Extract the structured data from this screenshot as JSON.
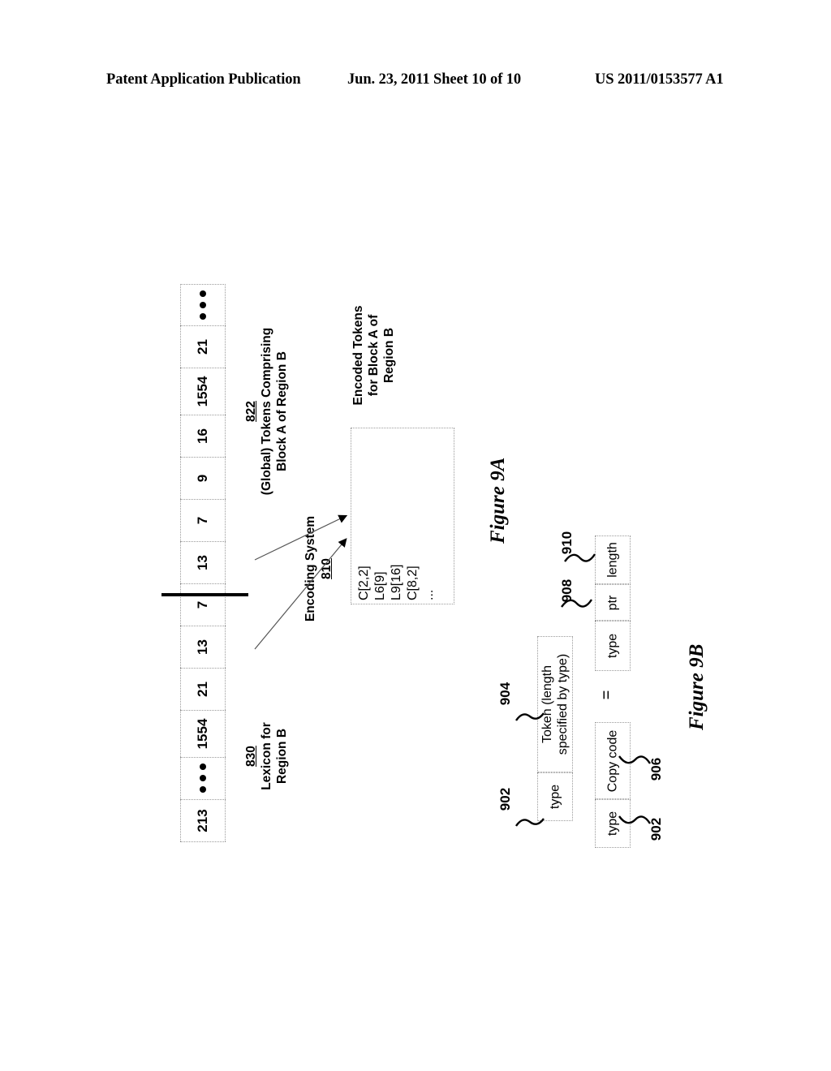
{
  "header": {
    "publication": "Patent Application Publication",
    "date_sheet": "Jun. 23, 2011  Sheet 10 of 10",
    "number": "US 2011/0153577 A1"
  },
  "figure_9a": {
    "caption": "Figure 9A",
    "token_strip": {
      "cells_bottom_to_top": [
        "213",
        "•••",
        "1554",
        "21",
        "13",
        "7",
        "13",
        "7",
        "9",
        "16",
        "1554",
        "21",
        "•••"
      ],
      "cells_top_to_bottom": [
        "•••",
        "21",
        "1554",
        "16",
        "9",
        "7",
        "13",
        "7",
        "13",
        "21",
        "1554",
        "•••",
        "213"
      ],
      "divider_after_index_from_bottom": 6
    },
    "label_822": {
      "ref": "822",
      "line1": "(Global) Tokens Comprising",
      "line2": "Block A of Region B"
    },
    "label_830": {
      "ref": "830",
      "line1": "Lexicon for",
      "line2": "Region B"
    },
    "encoding_system": {
      "name": "Encoding System",
      "ref": "810"
    },
    "encoded_box": {
      "title_line1": "Encoded Tokens",
      "title_line2": "for Block A of",
      "title_line3": "Region B",
      "entries": [
        "C[2,2]",
        "L6[9]",
        "L9[16]",
        "C[8,2]",
        "..."
      ]
    }
  },
  "figure_9b": {
    "caption": "Figure 9B",
    "row1": {
      "cells": [
        "type",
        "Token (length\nspecified by type)"
      ],
      "cell_type": "type",
      "cell_token_line1": "Token (length",
      "cell_token_line2": "specified by type)",
      "ref_type": "902",
      "ref_token": "904"
    },
    "row2": {
      "left_cells": [
        "type",
        "Copy code"
      ],
      "cell_type": "type",
      "cell_copy": "Copy code",
      "equals": "=",
      "right_cells": [
        "type",
        "ptr",
        "length"
      ],
      "cell_type2": "type",
      "cell_ptr": "ptr",
      "cell_length": "length",
      "ref_type_left": "902",
      "ref_copy": "906",
      "ref_ptr": "908",
      "ref_length": "910"
    }
  },
  "colors": {
    "ink": "#000000",
    "cell_border": "#9a9a9a",
    "paper": "#ffffff"
  }
}
